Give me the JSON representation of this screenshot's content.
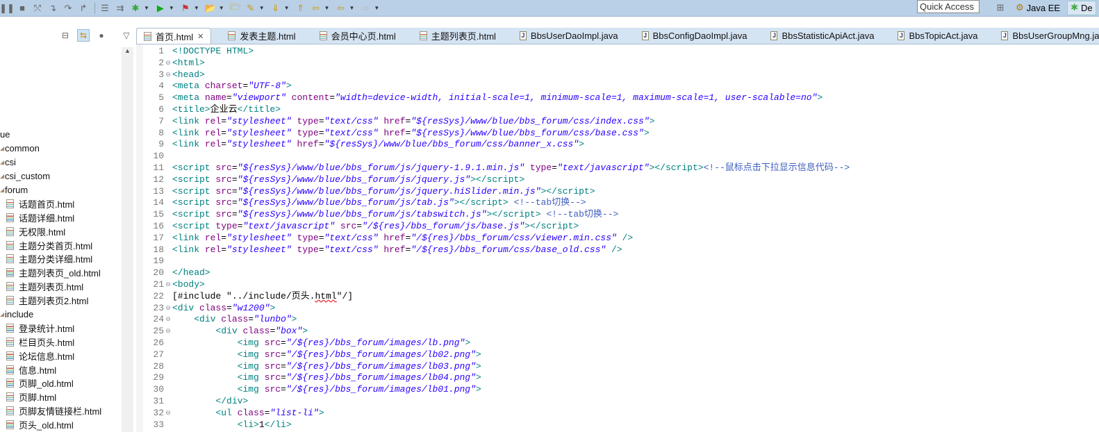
{
  "toolbar": {
    "icons": [
      "suspend-icon",
      "terminate-icon",
      "disconnect-icon",
      "step-into-icon",
      "step-over-icon",
      "step-return-icon",
      "use-step-filters-icon",
      "drop-to-frame-icon",
      "debug-icon",
      "run-icon",
      "external-tools-icon",
      "new-project-icon",
      "open-type-icon",
      "annotation-icon",
      "next-annotation-icon",
      "prev-annotation-icon",
      "last-edit-icon",
      "back-icon",
      "forward-icon"
    ],
    "quick_access": "Quick Access",
    "perspectives": [
      {
        "label": "Java EE"
      },
      {
        "label": "De"
      }
    ]
  },
  "sidebar": {
    "tree": [
      {
        "label": "ue",
        "kind": "folder",
        "level": 0
      },
      {
        "label": "common",
        "kind": "folder",
        "level": 1
      },
      {
        "label": "csi",
        "kind": "folder",
        "level": 1
      },
      {
        "label": "csi_custom",
        "kind": "folder",
        "level": 1
      },
      {
        "label": "forum",
        "kind": "folder",
        "level": 1
      },
      {
        "label": "话题首页.html",
        "kind": "file"
      },
      {
        "label": "话题详细.html",
        "kind": "file"
      },
      {
        "label": "无权限.html",
        "kind": "file"
      },
      {
        "label": "主题分类首页.html",
        "kind": "file"
      },
      {
        "label": "主题分类详细.html",
        "kind": "file"
      },
      {
        "label": "主题列表页_old.html",
        "kind": "file"
      },
      {
        "label": "主题列表页.html",
        "kind": "file"
      },
      {
        "label": "主题列表页2.html",
        "kind": "file"
      },
      {
        "label": "include",
        "kind": "folder",
        "level": 1
      },
      {
        "label": "登录统计.html",
        "kind": "file"
      },
      {
        "label": "栏目页头.html",
        "kind": "file"
      },
      {
        "label": "论坛信息.html",
        "kind": "file"
      },
      {
        "label": "信息.html",
        "kind": "file"
      },
      {
        "label": "页脚_old.html",
        "kind": "file"
      },
      {
        "label": "页脚.html",
        "kind": "file"
      },
      {
        "label": "页脚友情链接栏.html",
        "kind": "file"
      },
      {
        "label": "页头_old.html",
        "kind": "file"
      }
    ]
  },
  "tabs": [
    {
      "label": "首页.html",
      "type": "html",
      "active": true
    },
    {
      "label": "发表主题.html",
      "type": "html"
    },
    {
      "label": "会员中心页.html",
      "type": "html"
    },
    {
      "label": "主题列表页.html",
      "type": "html"
    },
    {
      "label": "BbsUserDaoImpl.java",
      "type": "java"
    },
    {
      "label": "BbsConfigDaoImpl.java",
      "type": "java"
    },
    {
      "label": "BbsStatisticApiAct.java",
      "type": "java"
    },
    {
      "label": "BbsTopicAct.java",
      "type": "java"
    },
    {
      "label": "BbsUserGroupMng.java",
      "type": "java"
    }
  ],
  "code": [
    {
      "n": "1",
      "tokens": [
        [
          "t",
          "<!DOCTYPE HTML>"
        ]
      ]
    },
    {
      "n": "2",
      "fold": true,
      "tokens": [
        [
          "t",
          "<html>"
        ]
      ]
    },
    {
      "n": "3",
      "fold": true,
      "tokens": [
        [
          "t",
          "<head>"
        ]
      ]
    },
    {
      "n": "4",
      "tokens": [
        [
          "t",
          "<meta "
        ],
        [
          "a",
          "charset"
        ],
        [
          "x",
          "="
        ],
        [
          "v",
          "\"UTF-8\""
        ],
        [
          "t",
          ">"
        ]
      ]
    },
    {
      "n": "5",
      "tokens": [
        [
          "t",
          "<meta "
        ],
        [
          "a",
          "name"
        ],
        [
          "x",
          "="
        ],
        [
          "v",
          "\"viewport\""
        ],
        [
          "t",
          " "
        ],
        [
          "a",
          "content"
        ],
        [
          "x",
          "="
        ],
        [
          "v",
          "\"width=device-width, initial-scale=1, minimum-scale=1, maximum-scale=1, user-scalable=no\""
        ],
        [
          "t",
          ">"
        ]
      ]
    },
    {
      "n": "6",
      "tokens": [
        [
          "t",
          "<title>"
        ],
        [
          "x",
          "企业云"
        ],
        [
          "t",
          "</title>"
        ]
      ]
    },
    {
      "n": "7",
      "tokens": [
        [
          "t",
          "<link "
        ],
        [
          "a",
          "rel"
        ],
        [
          "x",
          "="
        ],
        [
          "v",
          "\"stylesheet\""
        ],
        [
          "t",
          " "
        ],
        [
          "a",
          "type"
        ],
        [
          "x",
          "="
        ],
        [
          "v",
          "\"text/css\""
        ],
        [
          "t",
          " "
        ],
        [
          "a",
          "href"
        ],
        [
          "x",
          "="
        ],
        [
          "v",
          "\"${resSys}/www/blue/bbs_forum/css/index.css\""
        ],
        [
          "t",
          ">"
        ]
      ]
    },
    {
      "n": "8",
      "tokens": [
        [
          "t",
          "<link "
        ],
        [
          "a",
          "rel"
        ],
        [
          "x",
          "="
        ],
        [
          "v",
          "\"stylesheet\""
        ],
        [
          "t",
          " "
        ],
        [
          "a",
          "type"
        ],
        [
          "x",
          "="
        ],
        [
          "v",
          "\"text/css\""
        ],
        [
          "t",
          " "
        ],
        [
          "a",
          "href"
        ],
        [
          "x",
          "="
        ],
        [
          "v",
          "\"${resSys}/www/blue/bbs_forum/css/base.css\""
        ],
        [
          "t",
          ">"
        ]
      ]
    },
    {
      "n": "9",
      "tokens": [
        [
          "t",
          "<link "
        ],
        [
          "a",
          "rel"
        ],
        [
          "x",
          "="
        ],
        [
          "v",
          "\"stylesheet\""
        ],
        [
          "t",
          " "
        ],
        [
          "a",
          "href"
        ],
        [
          "x",
          "="
        ],
        [
          "v",
          "\"${resSys}/www/blue/bbs_forum/css/banner_x.css\""
        ],
        [
          "t",
          ">"
        ]
      ]
    },
    {
      "n": "10",
      "tokens": []
    },
    {
      "n": "11",
      "tokens": [
        [
          "t",
          "<script "
        ],
        [
          "a",
          "src"
        ],
        [
          "x",
          "="
        ],
        [
          "v",
          "\"${resSys}/www/blue/bbs_forum/js/jquery-1.9.1.min.js\""
        ],
        [
          "t",
          " "
        ],
        [
          "a",
          "type"
        ],
        [
          "x",
          "="
        ],
        [
          "v",
          "\"text/javascript\""
        ],
        [
          "t",
          "></script>"
        ],
        [
          "c",
          "<!--鼠标点击下拉显示信息代码-->"
        ]
      ]
    },
    {
      "n": "12",
      "tokens": [
        [
          "t",
          "<script "
        ],
        [
          "a",
          "src"
        ],
        [
          "x",
          "="
        ],
        [
          "v",
          "\"${resSys}/www/blue/bbs_forum/js/jquery.js\""
        ],
        [
          "t",
          "></script>"
        ]
      ]
    },
    {
      "n": "13",
      "tokens": [
        [
          "t",
          "<script "
        ],
        [
          "a",
          "src"
        ],
        [
          "x",
          "="
        ],
        [
          "v",
          "\"${resSys}/www/blue/bbs_forum/js/jquery.hiSlider.min.js\""
        ],
        [
          "t",
          "></script>"
        ]
      ]
    },
    {
      "n": "14",
      "tokens": [
        [
          "t",
          "<script "
        ],
        [
          "a",
          "src"
        ],
        [
          "x",
          "="
        ],
        [
          "v",
          "\"${resSys}/www/blue/bbs_forum/js/tab.js\""
        ],
        [
          "t",
          "></script> "
        ],
        [
          "c",
          "<!--tab切换-->"
        ]
      ]
    },
    {
      "n": "15",
      "tokens": [
        [
          "t",
          "<script "
        ],
        [
          "a",
          "src"
        ],
        [
          "x",
          "="
        ],
        [
          "v",
          "\"${resSys}/www/blue/bbs_forum/js/tabswitch.js\""
        ],
        [
          "t",
          "></script> "
        ],
        [
          "c",
          "<!--tab切换-->"
        ]
      ]
    },
    {
      "n": "16",
      "tokens": [
        [
          "t",
          "<script "
        ],
        [
          "a",
          "type"
        ],
        [
          "x",
          "="
        ],
        [
          "v",
          "\"text/javascript\""
        ],
        [
          "t",
          " "
        ],
        [
          "a",
          "src"
        ],
        [
          "x",
          "="
        ],
        [
          "v",
          "\"/${res}/bbs_forum/js/base.js\""
        ],
        [
          "t",
          "></script>"
        ]
      ]
    },
    {
      "n": "17",
      "tokens": [
        [
          "t",
          "<link "
        ],
        [
          "a",
          "rel"
        ],
        [
          "x",
          "="
        ],
        [
          "v",
          "\"stylesheet\""
        ],
        [
          "t",
          " "
        ],
        [
          "a",
          "type"
        ],
        [
          "x",
          "="
        ],
        [
          "v",
          "\"text/css\""
        ],
        [
          "t",
          " "
        ],
        [
          "a",
          "href"
        ],
        [
          "x",
          "="
        ],
        [
          "v",
          "\"/${res}/bbs_forum/css/viewer.min.css\""
        ],
        [
          "t",
          " />"
        ]
      ]
    },
    {
      "n": "18",
      "tokens": [
        [
          "t",
          "<link "
        ],
        [
          "a",
          "rel"
        ],
        [
          "x",
          "="
        ],
        [
          "v",
          "\"stylesheet\""
        ],
        [
          "t",
          " "
        ],
        [
          "a",
          "type"
        ],
        [
          "x",
          "="
        ],
        [
          "v",
          "\"text/css\""
        ],
        [
          "t",
          " "
        ],
        [
          "a",
          "href"
        ],
        [
          "x",
          "="
        ],
        [
          "v",
          "\"/${res}/bbs_forum/css/base_old.css\""
        ],
        [
          "t",
          " />"
        ]
      ]
    },
    {
      "n": "19",
      "tokens": []
    },
    {
      "n": "20",
      "tokens": [
        [
          "t",
          "</head>"
        ]
      ]
    },
    {
      "n": "21",
      "fold": true,
      "tokens": [
        [
          "t",
          "<body>"
        ]
      ]
    },
    {
      "n": "22",
      "tokens": [
        [
          "x",
          "[#include \"../include/页头."
        ],
        [
          "squig",
          "html"
        ],
        [
          "x",
          "\"/]"
        ]
      ]
    },
    {
      "n": "23",
      "fold": true,
      "tokens": [
        [
          "t",
          "<div "
        ],
        [
          "a",
          "class"
        ],
        [
          "x",
          "="
        ],
        [
          "v",
          "\"w1200\""
        ],
        [
          "t",
          ">"
        ]
      ]
    },
    {
      "n": "24",
      "fold": true,
      "tokens": [
        [
          "x",
          "    "
        ],
        [
          "t",
          "<div "
        ],
        [
          "a",
          "class"
        ],
        [
          "x",
          "="
        ],
        [
          "v",
          "\"lunbo\""
        ],
        [
          "t",
          ">"
        ]
      ]
    },
    {
      "n": "25",
      "fold": true,
      "tokens": [
        [
          "x",
          "        "
        ],
        [
          "t",
          "<div "
        ],
        [
          "a",
          "class"
        ],
        [
          "x",
          "="
        ],
        [
          "v",
          "\"box\""
        ],
        [
          "t",
          ">"
        ]
      ]
    },
    {
      "n": "26",
      "tokens": [
        [
          "x",
          "            "
        ],
        [
          "t",
          "<img "
        ],
        [
          "a",
          "src"
        ],
        [
          "x",
          "="
        ],
        [
          "v",
          "\"/${res}/bbs_forum/images/lb.png\""
        ],
        [
          "t",
          ">"
        ]
      ]
    },
    {
      "n": "27",
      "tokens": [
        [
          "x",
          "            "
        ],
        [
          "t",
          "<img "
        ],
        [
          "a",
          "src"
        ],
        [
          "x",
          "="
        ],
        [
          "v",
          "\"/${res}/bbs_forum/images/lb02.png\""
        ],
        [
          "t",
          ">"
        ]
      ]
    },
    {
      "n": "28",
      "tokens": [
        [
          "x",
          "            "
        ],
        [
          "t",
          "<img "
        ],
        [
          "a",
          "src"
        ],
        [
          "x",
          "="
        ],
        [
          "v",
          "\"/${res}/bbs_forum/images/lb03.png\""
        ],
        [
          "t",
          ">"
        ]
      ]
    },
    {
      "n": "29",
      "tokens": [
        [
          "x",
          "            "
        ],
        [
          "t",
          "<img "
        ],
        [
          "a",
          "src"
        ],
        [
          "x",
          "="
        ],
        [
          "v",
          "\"/${res}/bbs_forum/images/lb04.png\""
        ],
        [
          "t",
          ">"
        ]
      ]
    },
    {
      "n": "30",
      "tokens": [
        [
          "x",
          "            "
        ],
        [
          "t",
          "<img "
        ],
        [
          "a",
          "src"
        ],
        [
          "x",
          "="
        ],
        [
          "v",
          "\"/${res}/bbs_forum/images/lb01.png\""
        ],
        [
          "t",
          ">"
        ]
      ]
    },
    {
      "n": "31",
      "tokens": [
        [
          "x",
          "        "
        ],
        [
          "t",
          "</div>"
        ]
      ]
    },
    {
      "n": "32",
      "fold": true,
      "tokens": [
        [
          "x",
          "        "
        ],
        [
          "t",
          "<ul "
        ],
        [
          "a",
          "class"
        ],
        [
          "x",
          "="
        ],
        [
          "v",
          "\"list-li\""
        ],
        [
          "t",
          ">"
        ]
      ]
    },
    {
      "n": "33",
      "tokens": [
        [
          "x",
          "            "
        ],
        [
          "t",
          "<li>"
        ],
        [
          "x",
          "1"
        ],
        [
          "t",
          "</li>"
        ]
      ]
    }
  ]
}
